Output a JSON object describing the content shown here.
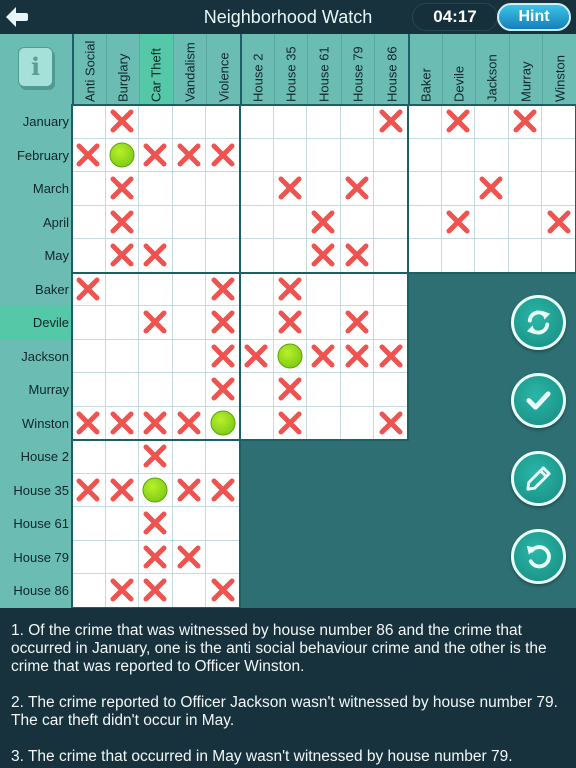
{
  "header": {
    "title": "Neighborhood Watch",
    "timer": "04:17",
    "hint_label": "Hint",
    "info_label": "i"
  },
  "columns": [
    {
      "label": "Anti Social",
      "group": "crime"
    },
    {
      "label": "Burglary",
      "group": "crime"
    },
    {
      "label": "Car Theft",
      "group": "crime",
      "highlight": true
    },
    {
      "label": "Vandalism",
      "group": "crime"
    },
    {
      "label": "Violence",
      "group": "crime"
    },
    {
      "label": "House 2",
      "group": "house"
    },
    {
      "label": "House 35",
      "group": "house"
    },
    {
      "label": "House 61",
      "group": "house"
    },
    {
      "label": "House 79",
      "group": "house"
    },
    {
      "label": "House 86",
      "group": "house"
    },
    {
      "label": "Baker",
      "group": "officer"
    },
    {
      "label": "Devile",
      "group": "officer"
    },
    {
      "label": "Jackson",
      "group": "officer"
    },
    {
      "label": "Murray",
      "group": "officer"
    },
    {
      "label": "Winston",
      "group": "officer"
    }
  ],
  "rows": [
    {
      "label": "January"
    },
    {
      "label": "February"
    },
    {
      "label": "March"
    },
    {
      "label": "April"
    },
    {
      "label": "May"
    },
    {
      "label": "Baker"
    },
    {
      "label": "Devile",
      "highlight": true
    },
    {
      "label": "Jackson"
    },
    {
      "label": "Murray"
    },
    {
      "label": "Winston"
    },
    {
      "label": "House 2"
    },
    {
      "label": "House 35"
    },
    {
      "label": "House 61"
    },
    {
      "label": "House 79"
    },
    {
      "label": "House 86"
    }
  ],
  "grid": {
    "legend": {
      "X": "cross",
      "O": "confirmed",
      ".": "empty"
    },
    "colors": {
      "cross": "#ef5350",
      "confirmed": "#8bd316",
      "highlight": "#55c9a7",
      "panel": "#6bbdb4"
    },
    "blocks": [
      {
        "name": "months-crimes",
        "row_start": 0,
        "col_start": 0,
        "cells": [
          ".X...",
          "XOXXX",
          ".X...",
          ".X...",
          ".XX.."
        ]
      },
      {
        "name": "months-houses",
        "row_start": 0,
        "col_start": 5,
        "cells": [
          "....X",
          ".....",
          ".X.X.",
          "..X..",
          "..XX."
        ]
      },
      {
        "name": "months-officers",
        "row_start": 0,
        "col_start": 10,
        "cells": [
          ".X.X.",
          ".....",
          "..X..",
          ".X..X",
          "....."
        ]
      },
      {
        "name": "officers-crimes",
        "row_start": 5,
        "col_start": 0,
        "cells": [
          "X...X",
          "..X.X",
          "....X",
          "....X",
          "XXXXO"
        ]
      },
      {
        "name": "officers-houses",
        "row_start": 5,
        "col_start": 5,
        "cells": [
          ".X...",
          ".X.X.",
          "XOXXX",
          ".X...",
          ".X..X"
        ]
      },
      {
        "name": "houses-crimes",
        "row_start": 10,
        "col_start": 0,
        "cells": [
          "..X..",
          "XXOXX",
          "..X..",
          "..XX.",
          ".XX.X"
        ]
      }
    ]
  },
  "side_buttons": [
    {
      "name": "swap-button",
      "icon": "refresh-icon"
    },
    {
      "name": "check-button",
      "icon": "checkmark-icon"
    },
    {
      "name": "pencil-button",
      "icon": "pencil-icon"
    },
    {
      "name": "undo-button",
      "icon": "undo-icon"
    }
  ],
  "clues": [
    "1. Of the crime that was witnessed by house number 86 and the crime that occurred in January, one is the anti social behaviour crime and the other is the crime that was reported to Officer Winston.",
    "2. The crime reported to Officer Jackson wasn't witnessed by house number 79. The car theft didn't occur in May.",
    "3. The crime that occurred in May wasn't witnessed by house number 79."
  ]
}
